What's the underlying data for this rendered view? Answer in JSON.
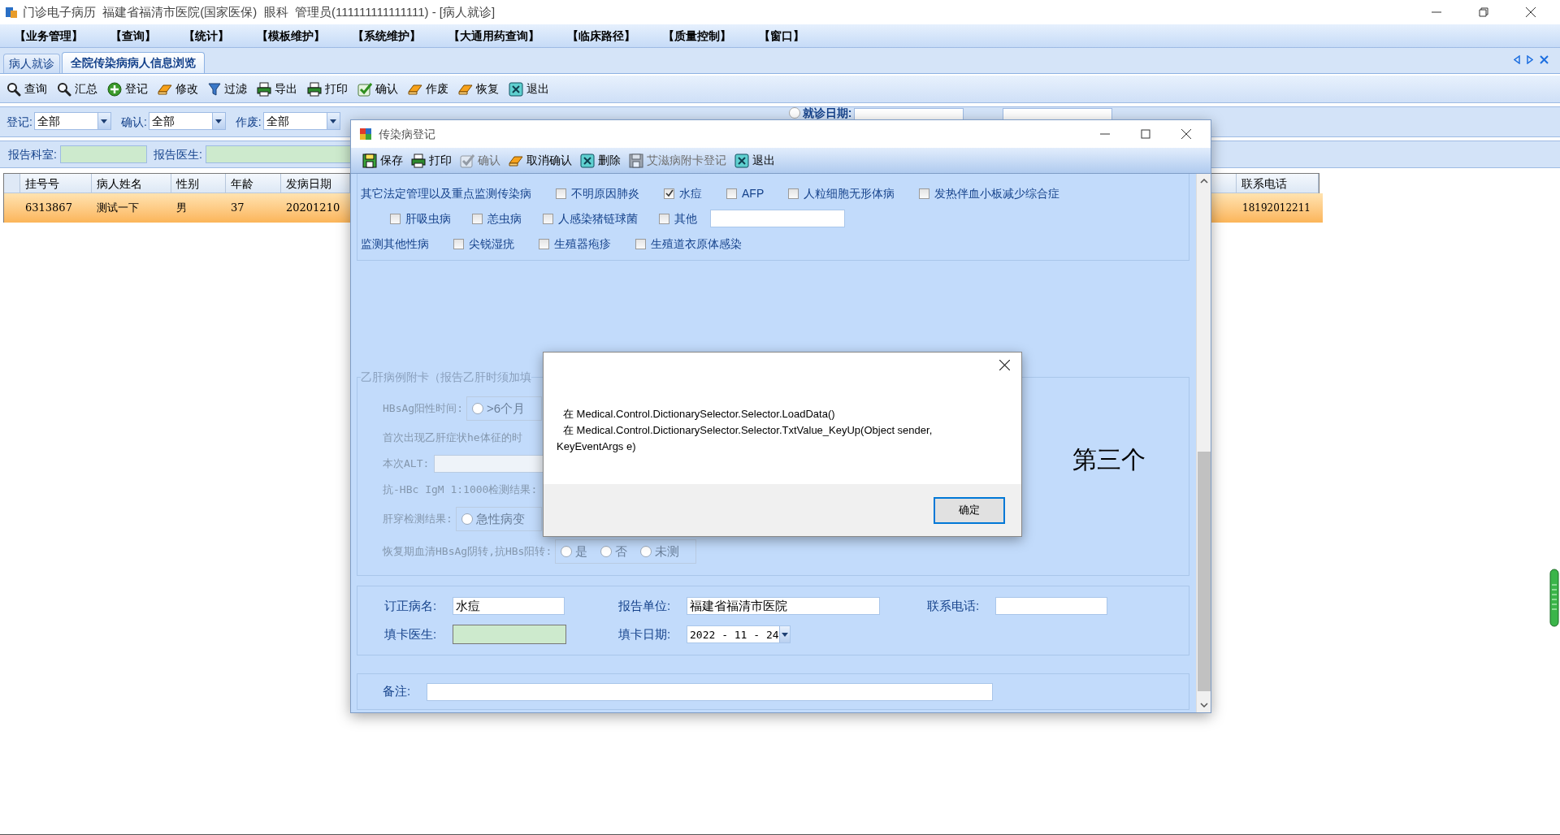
{
  "main_window": {
    "title": "门诊电子病历  福建省福清市医院(国家医保)  眼科  管理员(111111111111111) - [病人就诊]"
  },
  "menu": [
    "【业务管理】",
    "【查询】",
    "【统计】",
    "【模板维护】",
    "【系统维护】",
    "【大通用药查询】",
    "【临床路径】",
    "【质量控制】",
    "【窗口】"
  ],
  "tabs": [
    {
      "label": "病人就诊",
      "selected": false
    },
    {
      "label": "全院传染病病人信息浏览",
      "selected": true
    }
  ],
  "toolbar": [
    {
      "label": "查询",
      "kind": "magnifier"
    },
    {
      "label": "汇总",
      "kind": "magnifier"
    },
    {
      "label": "登记",
      "kind": "plus"
    },
    {
      "label": "修改",
      "kind": "eraser"
    },
    {
      "label": "过滤",
      "kind": "funnel"
    },
    {
      "label": "导出",
      "kind": "printer"
    },
    {
      "label": "打印",
      "kind": "printer"
    },
    {
      "label": "确认",
      "kind": "check"
    },
    {
      "label": "作废",
      "kind": "eraser"
    },
    {
      "label": "恢复",
      "kind": "eraser"
    },
    {
      "label": "退出",
      "kind": "exit"
    }
  ],
  "filters": [
    {
      "label": "登记:",
      "value": "全部"
    },
    {
      "label": "确认:",
      "value": "全部"
    },
    {
      "label": "作废:",
      "value": "全部"
    }
  ],
  "visit_date": {
    "label": "就诊日期:",
    "selected": false
  },
  "report_filters": [
    {
      "label": "报告科室:"
    },
    {
      "label": "报告医生:"
    }
  ],
  "table": {
    "columns": [
      "挂号号",
      "病人姓名",
      "性别",
      "年龄",
      "发病日期"
    ],
    "far_columns": [
      "联系电话"
    ],
    "rows": [
      {
        "selected": true,
        "cells": [
          "6313867",
          "测试一下",
          "男",
          "37",
          "20201210"
        ],
        "far_cells": [
          "18192012211"
        ]
      }
    ]
  },
  "dialog": {
    "title": "传染病登记",
    "toolbar": [
      {
        "label": "保存",
        "kind": "floppy",
        "disabled": false
      },
      {
        "label": "打印",
        "kind": "printer",
        "disabled": false
      },
      {
        "label": "确认",
        "kind": "check",
        "disabled": true
      },
      {
        "label": "取消确认",
        "kind": "eraser",
        "disabled": false
      },
      {
        "label": "删除",
        "kind": "exit",
        "disabled": false
      },
      {
        "label": "艾滋病附卡登记",
        "kind": "floppy",
        "disabled": true
      },
      {
        "label": "退出",
        "kind": "exit",
        "disabled": false
      }
    ],
    "other_diseases": [
      {
        "label": "其它法定管理以及重点监测传染病",
        "items": [
          {
            "label": "不明原因肺炎",
            "checked": false,
            "kind": "checkbox"
          },
          {
            "label": "水痘",
            "checked": true,
            "kind": "checkbox"
          },
          {
            "label": "AFP",
            "checked": false,
            "kind": "checkbox"
          },
          {
            "label": "人粒细胞无形体病",
            "checked": false,
            "kind": "checkbox"
          },
          {
            "label": "发热伴血小板减少综合症",
            "checked": false,
            "kind": "checkbox"
          }
        ]
      },
      {
        "items": [
          {
            "label": "肝吸虫病",
            "checked": false,
            "kind": "checkbox"
          },
          {
            "label": "恙虫病",
            "checked": false,
            "kind": "checkbox"
          },
          {
            "label": "人感染猪链球菌",
            "checked": false,
            "kind": "checkbox"
          },
          {
            "label": "其他",
            "checked": false,
            "kind": "other"
          }
        ]
      },
      {
        "label": "监测其他性病",
        "items": [
          {
            "label": "尖锐湿疣",
            "checked": false,
            "kind": "checkbox"
          },
          {
            "label": "生殖器疱疹",
            "checked": false,
            "kind": "checkbox"
          },
          {
            "label": "生殖道衣原体感染",
            "checked": false,
            "kind": "checkbox"
          }
        ]
      }
    ],
    "hepatitis_card": {
      "legend": "乙肝病例附卡（报告乙肝时须加填",
      "rows": [
        {
          "kind": "radios",
          "label": "HBsAg阳性时间:",
          "options": [
            {
              "label": ">6个月",
              "selected": false
            }
          ]
        },
        {
          "kind": "text",
          "label": "首次出现乙肝症状he体征的时"
        },
        {
          "kind": "field",
          "label": "本次ALT:"
        },
        {
          "kind": "text",
          "label": "抗-HBc IgM 1:1000检测结果:"
        },
        {
          "kind": "radios",
          "label": "肝穿检测结果:",
          "options": [
            {
              "label": "急性病变",
              "selected": false
            }
          ]
        },
        {
          "kind": "radios",
          "label": "恢复期血清HBsAg阴转,抗HBs阳转:",
          "options": [
            {
              "label": "是",
              "selected": false
            },
            {
              "label": "否",
              "selected": false
            },
            {
              "label": "未测",
              "selected": false
            }
          ]
        }
      ]
    },
    "report": [
      {
        "label": "订正病名:",
        "value": "水痘",
        "kind": "text"
      },
      {
        "label": "报告单位:",
        "value": "福建省福清市医院",
        "kind": "text"
      },
      {
        "label": "联系电话:",
        "kind": "text"
      },
      {
        "label": "填卡医生:",
        "kind": "lookup"
      },
      {
        "label": "填卡日期:",
        "value": "2022 - 11 - 24",
        "kind": "date"
      }
    ],
    "remark": {
      "label": "备注:"
    }
  },
  "message_box": {
    "lines": [
      "在 Medical.Control.DictionarySelector.Selector.LoadData()",
      "在 Medical.Control.DictionarySelector.Selector.TxtValue_KeyUp(Object sender, KeyEventArgs e)"
    ],
    "button": "确定"
  },
  "overlay_text": "第三个"
}
